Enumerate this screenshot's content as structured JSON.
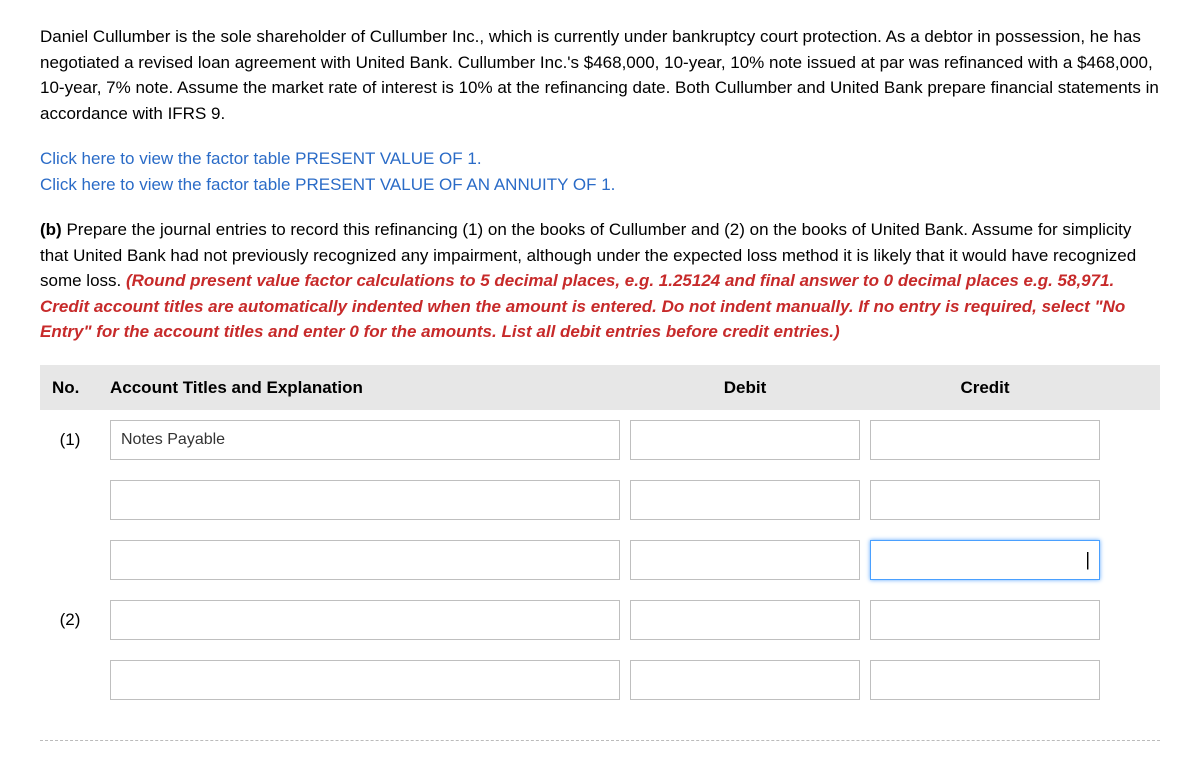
{
  "problem": {
    "paragraph1": "Daniel Cullumber is the sole shareholder of Cullumber Inc., which is currently under bankruptcy court protection. As a debtor in possession, he has negotiated a revised loan agreement with United Bank. Cullumber Inc.'s $468,000, 10-year, 10% note issued at par was refinanced with a $468,000, 10-year, 7% note. Assume the market rate of interest is 10% at the refinancing date. Both Cullumber and United Bank prepare financial statements in accordance with IFRS 9."
  },
  "links": {
    "pv1": "Click here to view the factor table PRESENT VALUE OF 1.",
    "pva1": "Click here to view the factor table PRESENT VALUE OF AN ANNUITY OF 1."
  },
  "partb": {
    "label": "(b) ",
    "body": "Prepare the journal entries to record this refinancing (1) on the books of Cullumber and (2) on the books of United Bank. Assume for simplicity that United Bank had not previously recognized any impairment, although under the expected loss method it is likely that it would have recognized some loss. ",
    "red": "(Round present value factor calculations to 5 decimal places, e.g. 1.25124 and final answer to 0 decimal places e.g. 58,971. Credit account titles are automatically indented when the amount is entered. Do not indent manually. If no entry is required, select \"No Entry\" for the account titles and enter 0 for the amounts. List all debit entries before credit entries.)"
  },
  "headers": {
    "no": "No.",
    "title": "Account Titles and Explanation",
    "debit": "Debit",
    "credit": "Credit"
  },
  "rows": [
    {
      "no": "(1)",
      "account": "Notes Payable",
      "debit": "",
      "credit": ""
    },
    {
      "no": "",
      "account": "",
      "debit": "",
      "credit": ""
    },
    {
      "no": "",
      "account": "",
      "debit": "",
      "credit": "",
      "credit_focused": true
    },
    {
      "no": "(2)",
      "account": "",
      "debit": "",
      "credit": ""
    },
    {
      "no": "",
      "account": "",
      "debit": "",
      "credit": ""
    }
  ]
}
